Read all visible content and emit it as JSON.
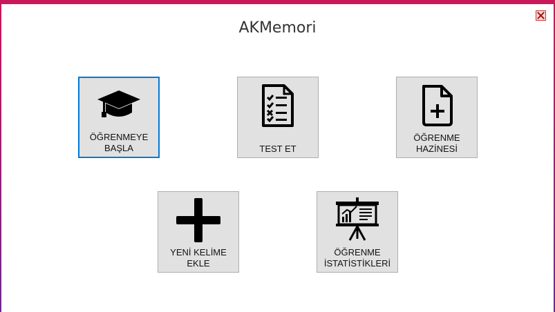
{
  "window": {
    "title": "AKMemori",
    "accent_color": "#c8185a",
    "selection_color": "#0078d7"
  },
  "tiles": [
    {
      "id": "learn",
      "label": "ÖĞRENMEYE\nBAŞLA",
      "icon": "graduation-cap-icon",
      "selected": true
    },
    {
      "id": "test",
      "label": "TEST ET",
      "icon": "checklist-icon",
      "selected": false
    },
    {
      "id": "vault",
      "label": "ÖĞRENME\nHAZİNESİ",
      "icon": "file-plus-icon",
      "selected": false
    },
    {
      "id": "add",
      "label": "YENİ KELİME\nEKLE",
      "icon": "plus-icon",
      "selected": false
    },
    {
      "id": "stats",
      "label": "ÖĞRENME\nİSTATİSTİKLERİ",
      "icon": "presentation-chart-icon",
      "selected": false
    }
  ]
}
